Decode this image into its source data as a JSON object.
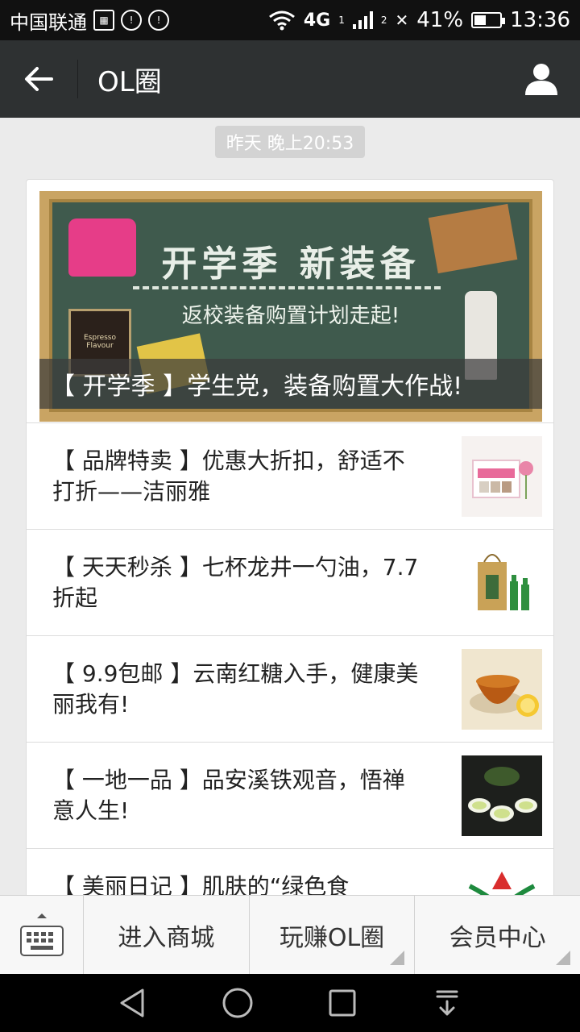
{
  "status_bar": {
    "carrier": "中国联通",
    "network": "4G",
    "sim1": "1",
    "sim2": "2",
    "battery": "41%",
    "time": "13:36"
  },
  "header": {
    "title": "OL圈"
  },
  "feed": {
    "timestamp": "昨天 晚上20:53",
    "cover": {
      "headline": "开学季 新装备",
      "subheadline": "返校装备购置计划走起!",
      "box_label": "Espresso Flavour",
      "caption": "【 开学季 】学生党，装备购置大作战!"
    },
    "items": [
      {
        "title": "【 品牌特卖 】优惠大折扣，舒适不打折——洁丽雅"
      },
      {
        "title": "【 天天秒杀 】七杯龙井一勺油，7.7折起"
      },
      {
        "title": "【 9.9包邮 】云南红糖入手，健康美丽我有!"
      },
      {
        "title": "【 一地一品 】品安溪铁观音，悟禅意人生!"
      },
      {
        "title": "【 美丽日记 】肌肤的“绿色食"
      }
    ]
  },
  "menu": {
    "items": [
      {
        "label": "进入商城"
      },
      {
        "label": "玩赚OL圈"
      },
      {
        "label": "会员中心"
      }
    ]
  },
  "colors": {
    "titlebar": "#2e3132",
    "background": "#ebebeb"
  }
}
